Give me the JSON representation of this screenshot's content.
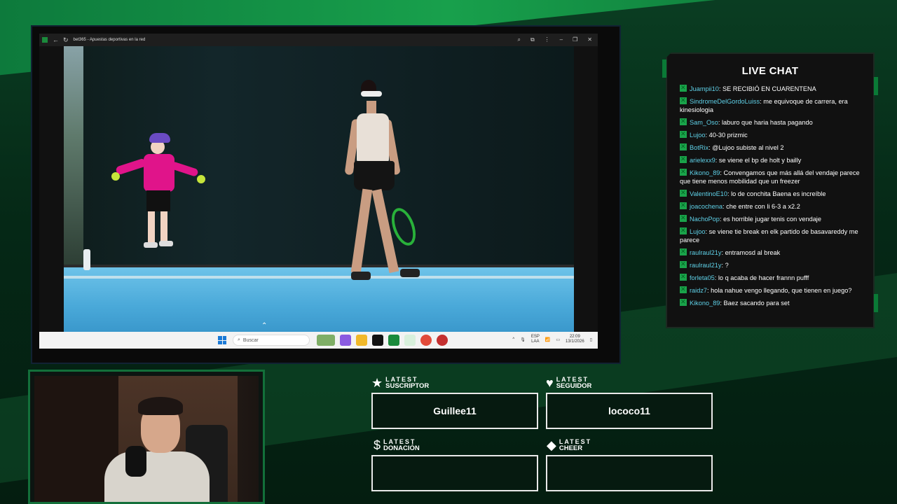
{
  "browser": {
    "tab_title": "bet365 - Apuestas deportivas en la red",
    "icons": [
      "back-icon",
      "refresh-icon",
      "zoom-icon",
      "extension-icon",
      "more-icon",
      "minimize-icon",
      "restore-icon",
      "close-icon"
    ]
  },
  "taskbar": {
    "search_placeholder": "Buscar",
    "tray_lang_top": "ESP",
    "tray_lang_bottom": "LAA",
    "time": "22:09",
    "date": "13/1/2026"
  },
  "chat": {
    "title": "LIVE CHAT",
    "messages": [
      {
        "user": "Juampii10",
        "text": "SE RECIBIÓ EN CUARENTENA"
      },
      {
        "user": "SindromeDelGordoLuiss",
        "text": "me equivoque de carrera, era kinesiologia"
      },
      {
        "user": "Sam_Oso",
        "text": "laburo que haria hasta pagando"
      },
      {
        "user": "Lujoo",
        "text": "40-30 prizmic"
      },
      {
        "user": "BotRix",
        "text": "@Lujoo subiste al nivel 2"
      },
      {
        "user": "arielexx9",
        "text": "se viene el bp de holt y bailly"
      },
      {
        "user": "Kikono_89",
        "text": "Convengamos que más allá del vendaje parece que tiene menos mobilidad que un freezer"
      },
      {
        "user": "ValentinoE10",
        "text": "lo de conchita Baena es increíble"
      },
      {
        "user": "joacochena",
        "text": "che entre con li 6-3 a x2.2"
      },
      {
        "user": "NachoPop",
        "text": "es horrible jugar tenis con vendaje"
      },
      {
        "user": "Lujoo",
        "text": "se viene tie break en elk partido de basavareddy me parece"
      },
      {
        "user": "raulraul21y",
        "text": "entramosd al break"
      },
      {
        "user": "raulraul21y",
        "text": "?"
      },
      {
        "user": "forleta05",
        "text": "lo q acaba de hacer frannn pufff"
      },
      {
        "user": "raidz7",
        "text": "hola nahue vengo llegando, que tienen en juego?"
      },
      {
        "user": "Kikono_89",
        "text": "Baez sacando para set"
      }
    ]
  },
  "widgets": {
    "suscriptor": {
      "line1": "LATEST",
      "line2": "SUSCRIPTOR",
      "value": "Guillee11",
      "icon": "star-icon"
    },
    "seguidor": {
      "line1": "LATEST",
      "line2": "SEGUIDOR",
      "value": "lococo11",
      "icon": "heart-icon"
    },
    "donacion": {
      "line1": "LATEST",
      "line2": "DONACIÓN",
      "value": "",
      "icon": "dollar-icon"
    },
    "cheer": {
      "line1": "LATEST",
      "line2": "CHEER",
      "value": "",
      "icon": "diamond-icon"
    }
  },
  "colors": {
    "accent_green": "#1aa34a",
    "chat_username": "#5fd1e8",
    "background": "#052816"
  }
}
